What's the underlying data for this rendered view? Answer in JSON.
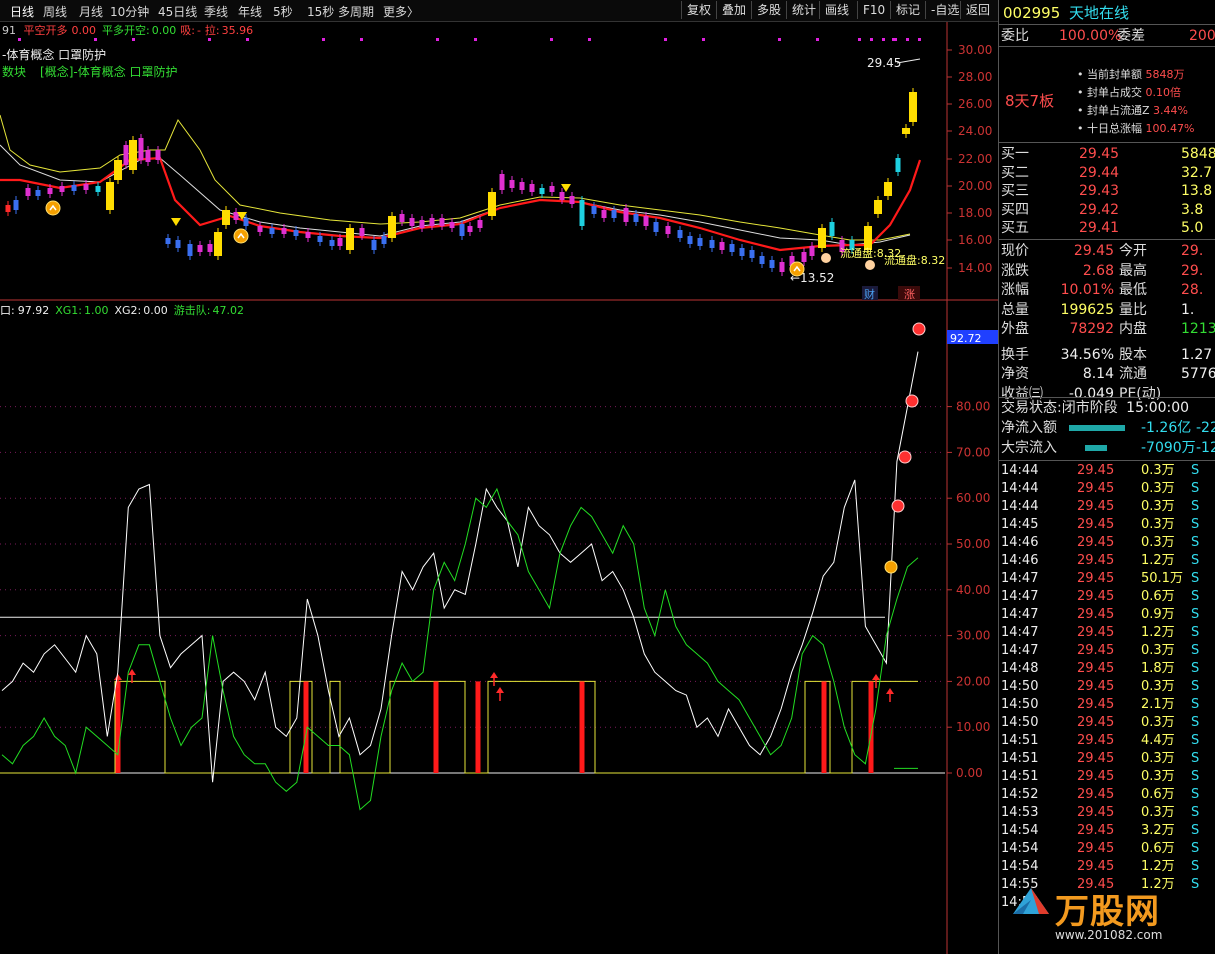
{
  "toolbar": {
    "periods": [
      "日线",
      "周线",
      "月线",
      "10分钟",
      "45日线",
      "季线",
      "年线",
      "5秒",
      "15秒",
      "多周期",
      "更多〉"
    ],
    "tools": [
      "复权",
      "叠加",
      "多股",
      "统计",
      "画线",
      "F10",
      "标记",
      "-自选",
      "返回"
    ]
  },
  "main_chart": {
    "indicator_line": {
      "prefix": "91",
      "a_label": "平空开多",
      "a_val": "0.00",
      "b_label": "平多开空:",
      "b_val": "0.00",
      "c_label": "吸:",
      "c_val": "-",
      "d_label": "拉:",
      "d_val": "35.96"
    },
    "concept_line1": "-体育概念 口罩防护",
    "concept_line2_a": "数块",
    "concept_line2_b": "[概念]-体育概念 口罩防护",
    "price_axis": [
      "30.00",
      "28.00",
      "26.00",
      "24.00",
      "22.00",
      "20.00",
      "18.00",
      "16.00",
      "14.00"
    ],
    "annotations": {
      "high_label": "29.45",
      "low_label": "13.52",
      "float1": "流通盘:8.32",
      "float2": "流通盘:8.32",
      "cai": "财",
      "zhang": "涨"
    }
  },
  "sub_chart": {
    "legend": {
      "a_label": "口:",
      "a_val": "97.92",
      "b_label": "XG1:",
      "b_val": "1.00",
      "c_label": "XG2:",
      "c_val": "0.00",
      "d_label": "游击队:",
      "d_val": "47.02"
    },
    "current_value": "92.72",
    "axis": [
      "80.00",
      "70.00",
      "60.00",
      "50.00",
      "40.00",
      "30.00",
      "20.00",
      "10.00",
      "0.00"
    ]
  },
  "chart_data": {
    "type": "line",
    "title": "",
    "series": [
      {
        "name": "white",
        "values": [
          18,
          20,
          24,
          22,
          26,
          28,
          25,
          22,
          30,
          26,
          8,
          22,
          58,
          62,
          63,
          30,
          23,
          26,
          28,
          30,
          -2,
          20,
          22,
          20,
          16,
          22,
          10,
          8,
          12,
          38,
          30,
          18,
          8,
          12,
          4,
          6,
          14,
          30,
          44,
          40,
          45,
          48,
          36,
          40,
          39,
          50,
          62,
          58,
          55,
          45,
          58,
          54,
          52,
          48,
          46,
          48,
          50,
          42,
          44,
          40,
          34,
          26,
          22,
          20,
          18,
          17,
          10,
          12,
          8,
          14,
          10,
          6,
          4,
          8,
          14,
          22,
          28,
          35,
          43,
          46,
          58,
          64,
          32,
          28,
          24,
          68,
          80,
          92
        ]
      },
      {
        "name": "green",
        "values": [
          4,
          2,
          6,
          8,
          12,
          8,
          6,
          0,
          10,
          8,
          6,
          4,
          22,
          28,
          28,
          20,
          12,
          6,
          10,
          12,
          30,
          18,
          8,
          4,
          2,
          2,
          -2,
          -4,
          -2,
          10,
          8,
          6,
          6,
          4,
          -8,
          -6,
          8,
          18,
          24,
          20,
          22,
          40,
          46,
          42,
          50,
          60,
          58,
          62,
          55,
          52,
          44,
          40,
          36,
          48,
          54,
          58,
          56,
          52,
          48,
          54,
          50,
          36,
          30,
          40,
          32,
          28,
          26,
          24,
          20,
          18,
          16,
          12,
          8,
          4,
          6,
          12,
          26,
          30,
          28,
          20,
          10,
          4,
          2,
          14,
          30,
          38,
          45,
          47
        ]
      }
    ],
    "ylim": [
      -10,
      100
    ]
  },
  "right_panel": {
    "stock_code": "002995",
    "stock_name": "天地在线",
    "weibi_label": "委比",
    "weibi_val": "100.00%",
    "weicha_label": "委差",
    "weicha_val": "200",
    "boards": "8天7板",
    "seal_items": [
      {
        "label": "当前封单额",
        "val": "5848万"
      },
      {
        "label": "封单占成交",
        "val": "0.10倍"
      },
      {
        "label": "封单占流通Z",
        "val": "3.44%"
      },
      {
        "label": "十日总涨幅",
        "val": "100.47%"
      }
    ],
    "bids": [
      {
        "label": "买一",
        "price": "29.45",
        "vol": "5848"
      },
      {
        "label": "买二",
        "price": "29.44",
        "vol": "32.7"
      },
      {
        "label": "买三",
        "price": "29.43",
        "vol": "13.8"
      },
      {
        "label": "买四",
        "price": "29.42",
        "vol": "3.8"
      },
      {
        "label": "买五",
        "price": "29.41",
        "vol": "5.0"
      }
    ],
    "quote": [
      {
        "l1": "现价",
        "v1": "29.45",
        "l2": "今开",
        "v2": "29."
      },
      {
        "l1": "涨跌",
        "v1": "2.68",
        "l2": "最高",
        "v2": "29."
      },
      {
        "l1": "涨幅",
        "v1": "10.01%",
        "l2": "最低",
        "v2": "28."
      },
      {
        "l1": "总量",
        "v1": "199625",
        "l2": "量比",
        "v2": "1."
      },
      {
        "l1": "外盘",
        "v1": "78292",
        "l2": "内盘",
        "v2": "1213"
      },
      {
        "l1": "换手",
        "v1": "34.56%",
        "l2": "股本",
        "v2": "1.27"
      },
      {
        "l1": "净资",
        "v1": "8.14",
        "l2": "流通",
        "v2": "5776"
      },
      {
        "l1": "收益㈢",
        "v1": "-0.049",
        "l2": "PE(动)",
        "v2": ""
      }
    ],
    "trade_status_label": "交易状态:",
    "trade_status": "闭市阶段",
    "trade_time": "15:00:00",
    "netflow_label": "净流入额",
    "netflow_val": "-1.26亿",
    "netflow_val2": "-22",
    "block_label": "大宗流入",
    "block_val": "-7090万",
    "block_val2": "-12",
    "ticks": [
      {
        "t": "14:44",
        "p": "29.45",
        "v": "0.3万",
        "s": "S"
      },
      {
        "t": "14:44",
        "p": "29.45",
        "v": "0.3万",
        "s": "S"
      },
      {
        "t": "14:44",
        "p": "29.45",
        "v": "0.3万",
        "s": "S"
      },
      {
        "t": "14:45",
        "p": "29.45",
        "v": "0.3万",
        "s": "S"
      },
      {
        "t": "14:46",
        "p": "29.45",
        "v": "0.3万",
        "s": "S"
      },
      {
        "t": "14:46",
        "p": "29.45",
        "v": "1.2万",
        "s": "S"
      },
      {
        "t": "14:47",
        "p": "29.45",
        "v": "50.1万",
        "s": "S"
      },
      {
        "t": "14:47",
        "p": "29.45",
        "v": "0.6万",
        "s": "S"
      },
      {
        "t": "14:47",
        "p": "29.45",
        "v": "0.9万",
        "s": "S"
      },
      {
        "t": "14:47",
        "p": "29.45",
        "v": "1.2万",
        "s": "S"
      },
      {
        "t": "14:47",
        "p": "29.45",
        "v": "0.3万",
        "s": "S"
      },
      {
        "t": "14:48",
        "p": "29.45",
        "v": "1.8万",
        "s": "S"
      },
      {
        "t": "14:50",
        "p": "29.45",
        "v": "0.3万",
        "s": "S"
      },
      {
        "t": "14:50",
        "p": "29.45",
        "v": "2.1万",
        "s": "S"
      },
      {
        "t": "14:50",
        "p": "29.45",
        "v": "0.3万",
        "s": "S"
      },
      {
        "t": "14:51",
        "p": "29.45",
        "v": "4.4万",
        "s": "S"
      },
      {
        "t": "14:51",
        "p": "29.45",
        "v": "0.3万",
        "s": "S"
      },
      {
        "t": "14:51",
        "p": "29.45",
        "v": "0.3万",
        "s": "S"
      },
      {
        "t": "14:52",
        "p": "29.45",
        "v": "0.6万",
        "s": "S"
      },
      {
        "t": "14:53",
        "p": "29.45",
        "v": "0.3万",
        "s": "S"
      },
      {
        "t": "14:54",
        "p": "29.45",
        "v": "3.2万",
        "s": "S"
      },
      {
        "t": "14:54",
        "p": "29.45",
        "v": "0.6万",
        "s": "S"
      },
      {
        "t": "14:54",
        "p": "29.45",
        "v": "1.2万",
        "s": "S"
      },
      {
        "t": "14:55",
        "p": "29.45",
        "v": "1.2万",
        "s": "S"
      },
      {
        "t": "14:55",
        "p": "",
        "v": "",
        "s": ""
      }
    ],
    "watermark": "万股网",
    "watermark_url": "www.201082.com"
  }
}
